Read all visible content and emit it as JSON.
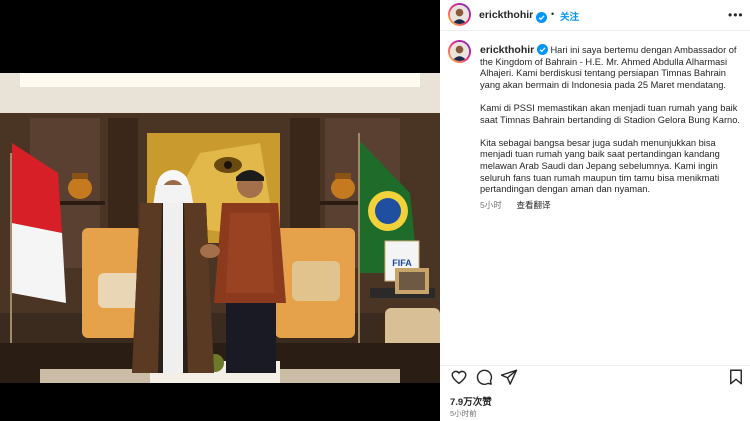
{
  "post": {
    "username": "erickthohir",
    "follow_label": "关注",
    "caption_paragraphs": [
      "Hari ini saya bertemu dengan Ambassador of the Kingdom of Bahrain - H.E. Mr. Ahmed Abdulla Alharmasi Alhajeri. Kami berdiskusi tentang persiapan Timnas Bahrain yang akan bermain di Indonesia pada 25 Maret mendatang.",
      "Kami di PSSI memastikan akan menjadi tuan rumah yang baik saat Timnas Bahrain bertanding di Stadion Gelora Bung Karno.",
      "Kita sebagai bangsa besar juga sudah menunjukkan bisa menjadi tuan rumah yang baik saat pertandingan kandang melawan Arab Saudi dan Jepang sebelumnya. Kami ingin seluruh fans tuan rumah maupun tim tamu bisa menikmati pertandingan dengan aman dan nyaman."
    ],
    "caption_time": "5小时",
    "see_translation": "查看翻译",
    "likes": "7.9万次赞",
    "time_ago": "5小时前"
  },
  "photo": {
    "fifa_label": "FIFA"
  },
  "icons": {
    "more": "more-options-icon",
    "like": "heart-icon",
    "comment": "comment-icon",
    "share": "share-icon",
    "save": "bookmark-icon",
    "verified": "verified-badge-icon"
  },
  "colors": {
    "link_blue": "#0095f6",
    "verified_blue": "#0095f6",
    "text": "#262626",
    "muted": "#737373"
  }
}
